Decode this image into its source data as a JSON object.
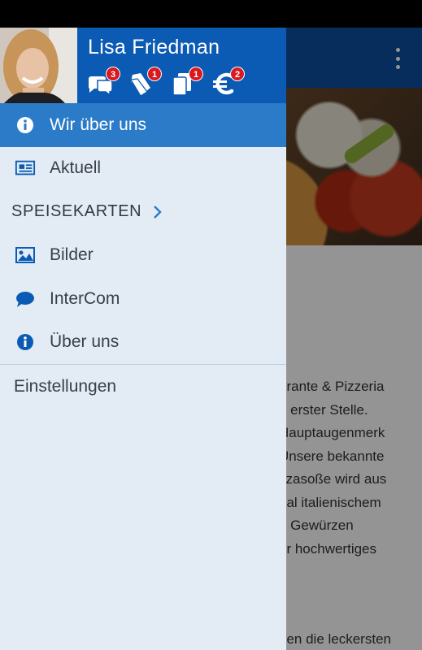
{
  "app": {
    "body_lines": [
      "orante & Pizzeria",
      "n erster Stelle.",
      " Hauptaugenmerk",
      "Unsere bekannte",
      "zzasoße wird aus",
      "nal italienischem",
      "n Gewürzen",
      "ur hochwertiges"
    ],
    "footer_line": "hen die leckersten"
  },
  "drawer": {
    "user_name": "Lisa Friedman",
    "badges": [
      {
        "icon": "chat-bubbles-icon",
        "count": "3"
      },
      {
        "icon": "coupon-icon",
        "count": "1"
      },
      {
        "icon": "cards-icon",
        "count": "1"
      },
      {
        "icon": "euro-icon",
        "count": "2"
      }
    ],
    "menu": {
      "wir_ueber_uns": "Wir über uns",
      "aktuell": "Aktuell",
      "speisekarten": "SPEISEKARTEN",
      "bilder": "Bilder",
      "intercom": "InterCom",
      "ueber_uns": "Über uns",
      "einstellungen": "Einstellungen"
    }
  },
  "colors": {
    "drawer_header": "#0b5bb4",
    "active_item": "#2b7bc8",
    "drawer_bg": "#e3ecf5",
    "icon_blue": "#0b5bb4",
    "badge_red": "#d8191e"
  }
}
